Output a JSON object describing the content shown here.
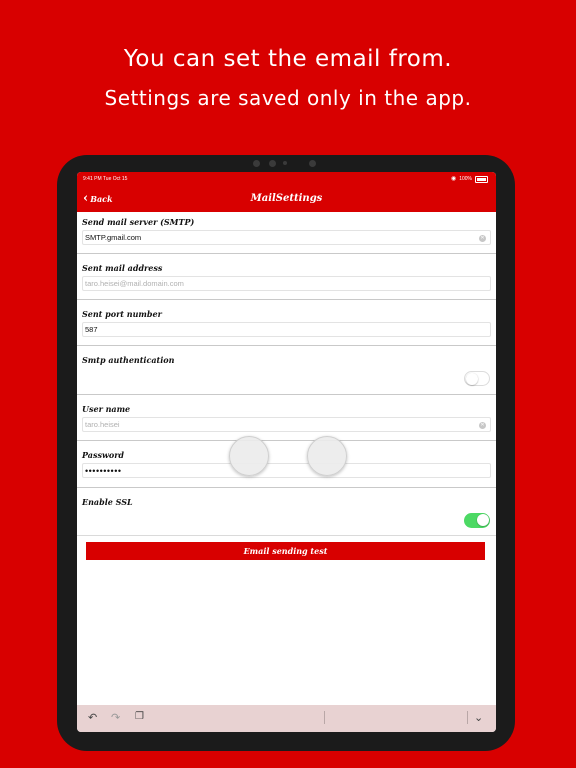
{
  "promo": {
    "line1": "You can set the email from.",
    "line2": "Settings are saved only in the app."
  },
  "statusbar": {
    "time": "9:41 PM   Tue Oct 15",
    "battery": "100%"
  },
  "nav": {
    "back_label": "Back",
    "title": "MailSettings"
  },
  "form": {
    "smtp_label": "Send mail server (SMTP)",
    "smtp_value": "SMTP.gmail.com",
    "address_label": "Sent mail address",
    "address_placeholder": "taro.heisei@mail.domain.com",
    "port_label": "Sent port number",
    "port_value": "587",
    "auth_label": "Smtp authentication",
    "auth_enabled": false,
    "username_label": "User name",
    "username_placeholder": "taro.heisei",
    "password_label": "Password",
    "password_value": "••••••••••",
    "ssl_label": "Enable SSL",
    "ssl_enabled": true
  },
  "actions": {
    "test_button": "Email sending test"
  },
  "icons": {
    "undo": "undo-icon",
    "redo": "redo-icon",
    "paste": "paste-icon",
    "dismiss": "keyboard-dismiss-icon"
  },
  "colors": {
    "brand_red": "#d80000",
    "toggle_on": "#4cd964"
  }
}
